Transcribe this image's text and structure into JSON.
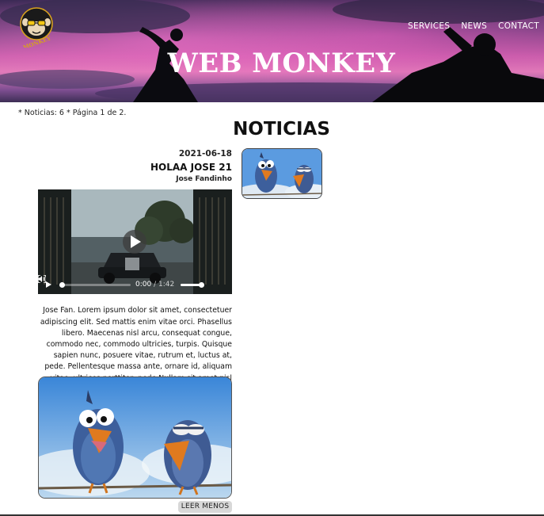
{
  "header": {
    "logo_text": "WEB MONKEY",
    "site_title": "WEB MONKEY",
    "nav": [
      "SERVICES",
      "NEWS",
      "CONTACT"
    ]
  },
  "listing": {
    "meta": "* Noticias: 6 * Página 1 de 2.",
    "section_title": "NOTICIAS"
  },
  "post": {
    "date": "2021-06-18",
    "title": "HOLAA JOSE 21",
    "author": "Jose Fandinho",
    "video": {
      "current_time": "0:00",
      "total_time": "1:42",
      "progress": 0,
      "volume": 1
    },
    "body": "Jose Fan. Lorem ipsum dolor sit amet, consectetuer adipiscing elit. Sed mattis enim vitae orci. Phasellus libero. Maecenas nisl arcu, consequat congue, commodo nec, commodo ultricies, turpis. Quisque sapien nunc, posuere vitae, rutrum et, luctus at, pede. Pellentesque massa ante, ornare id, aliquam vitae, ultrices porttitor, pede.Nullam sit amet nisl elementum elit convallis malesuada.",
    "read_less_label": "LEER MENOS"
  },
  "colors": {
    "hero_sky_pink": "#e07bb8",
    "hero_sky_purple": "#6a3e79",
    "button_bg": "#d8d8d8",
    "bird_blue": "#3d5f9c",
    "bird_beak": "#e07a1f"
  },
  "icons": {
    "logo": "monkey-sunglasses-logo",
    "play": "play-icon",
    "big_play": "play-circle-icon",
    "volume": "volume-icon",
    "fullscreen": "fullscreen-icon"
  }
}
